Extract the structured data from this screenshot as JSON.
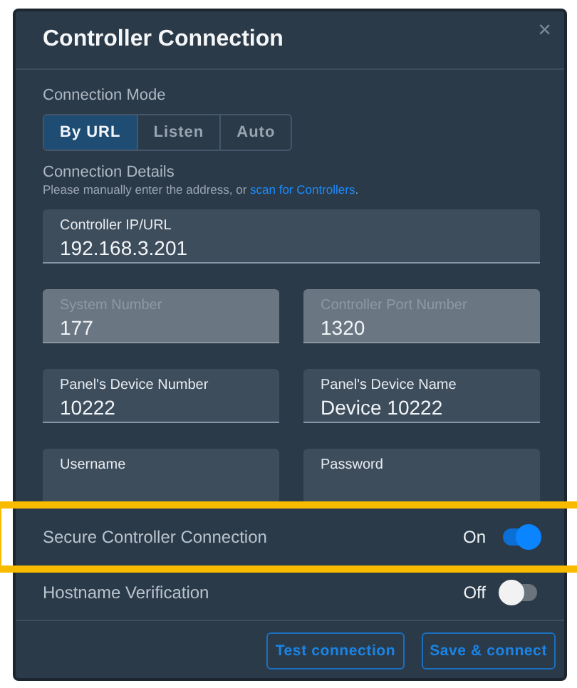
{
  "dialog": {
    "title": "Controller Connection",
    "close": "×"
  },
  "connection_mode": {
    "heading": "Connection Mode",
    "modes": [
      {
        "label": "By URL",
        "selected": true
      },
      {
        "label": "Listen",
        "selected": false
      },
      {
        "label": "Auto",
        "selected": false
      }
    ]
  },
  "connection_details": {
    "heading": "Connection Details",
    "hint_start": "Please manually enter the address, or ",
    "hint_link": "scan for Controllers",
    "hint_end": ".",
    "rows": [
      [
        {
          "label": "Controller IP/URL",
          "value": "192.168.3.201",
          "disabled": false
        }
      ],
      [
        {
          "label": "System Number",
          "value": "177",
          "disabled": true
        },
        {
          "label": "Controller Port Number",
          "value": "1320",
          "disabled": true
        }
      ],
      [
        {
          "label": "Panel's Device Number",
          "value": "10222",
          "disabled": false
        },
        {
          "label": "Panel's Device Name",
          "value": "Device 10222",
          "disabled": false
        }
      ],
      [
        {
          "label": "Username",
          "disabled": false
        },
        {
          "label": "Password",
          "disabled": false
        }
      ]
    ]
  },
  "toggles": [
    {
      "label": "Secure Controller Connection",
      "state_text": "On",
      "on": true,
      "highlighted": true
    },
    {
      "label": "Hostname Verification",
      "state_text": "Off",
      "on": false,
      "highlighted": false
    }
  ],
  "buttons": [
    "Test connection",
    "Save & connect"
  ]
}
